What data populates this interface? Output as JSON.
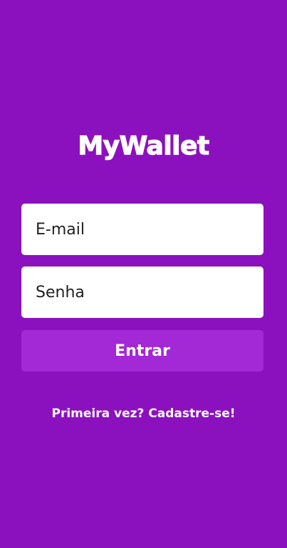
{
  "app": {
    "logo": "MyWallet"
  },
  "login_form": {
    "email_placeholder": "E-mail",
    "email_value": "",
    "password_placeholder": "Senha",
    "password_value": "",
    "submit_label": "Entrar"
  },
  "signup": {
    "link_text": "Primeira vez? Cadastre-se!"
  },
  "colors": {
    "background": "#8C11BE",
    "button": "#A328D6",
    "input_background": "#FFFFFF",
    "text_light": "#FFFFFF"
  }
}
